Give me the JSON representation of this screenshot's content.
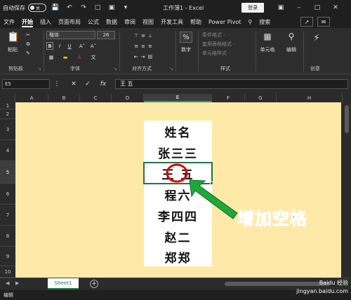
{
  "titlebar": {
    "autosave": "自动保存",
    "autosave_state": "关",
    "doc_title": "工作薄1  -  Excel",
    "login": "登录"
  },
  "tabs": [
    "文件",
    "开始",
    "插入",
    "页面布局",
    "公式",
    "数据",
    "审阅",
    "视图",
    "开发工具",
    "帮助",
    "Power Pivot",
    "搜索"
  ],
  "active_tab": "开始",
  "ribbon": {
    "paste": "粘贴",
    "font_name": "楷体",
    "font_size": "26",
    "number": "数字",
    "cond_format": "条件格式 -",
    "table_format": "套用表格格式 -",
    "cell_style": "单元格样式 -",
    "cells": "单元格",
    "edit": "编辑",
    "groups": {
      "clipboard": "剪贴板",
      "font": "字体",
      "align": "对齐方式",
      "styles": "样式",
      "ideas": "创意"
    }
  },
  "formula_bar": {
    "name_box": "E5",
    "content": "王 五"
  },
  "columns": [
    "A",
    "B",
    "C",
    "D",
    "E",
    "F",
    "G",
    "H"
  ],
  "selected_column": "E",
  "rows": [
    "1",
    "2",
    "3",
    "4",
    "5",
    "6",
    "7",
    "8",
    "9",
    "10"
  ],
  "selected_row": "5",
  "cells_e": [
    "姓名",
    "张三三",
    "王  五",
    "程六",
    "李四四",
    "赵二",
    "郑郑"
  ],
  "annotation": "增加空格",
  "sheet_tab": "Sheet1",
  "status": "编辑",
  "watermark": {
    "line1": "Baidu 经验",
    "line2": "jingyan.baidu.com"
  },
  "colors": {
    "excel_green": "#217346",
    "sheet_bg": "#ffe9a8",
    "annotation_red": "#e00000",
    "arrow_green": "#1fa83a"
  }
}
